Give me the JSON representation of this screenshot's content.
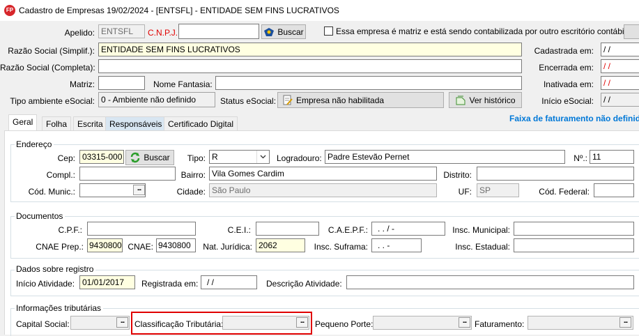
{
  "window": {
    "title": "Cadastro de Empresas  19/02/2024 - [ENTSFL] - ENTIDADE SEM FINS LUCRATIVOS",
    "icon_text": "FP"
  },
  "header": {
    "apelido_label": "Apelido:",
    "apelido_value": "ENTSFL",
    "cnpj_label": "C.N.P.J.:",
    "cnpj_value": "",
    "buscar_label": "Buscar",
    "matriz_check_label": "Essa empresa é matriz e está sendo contabilizada por outro escritório contábil",
    "razao_simpl_label": "Razão Social (Simplif.):",
    "razao_simpl_value": "ENTIDADE SEM FINS LUCRATIVOS",
    "razao_compl_label": "Razão Social (Completa):",
    "razao_compl_value": "",
    "matriz_label": "Matriz:",
    "matriz_value": "",
    "nome_fantasia_label": "Nome Fantasia:",
    "nome_fantasia_value": "",
    "tipo_amb_label": "Tipo ambiente eSocial:",
    "tipo_amb_value": "0 - Ambiente não definido",
    "status_label": "Status eSocial:",
    "status_value": "Empresa não habilitada",
    "historico_label": "Ver histórico",
    "cadastrada_label": "Cadastrada em:",
    "cadastrada_value": "/  /",
    "encerrada_label": "Encerrada em:",
    "encerrada_value": "/  /",
    "inativada_label": "Inativada em:",
    "inativada_value": "/  /",
    "inicio_esocial_label": "Início eSocial:",
    "inicio_esocial_value": "/  /"
  },
  "tabs": [
    {
      "label": "Geral"
    },
    {
      "label": "Folha"
    },
    {
      "label": "Escrita"
    },
    {
      "label": "Responsáveis"
    },
    {
      "label": "Certificado Digital"
    }
  ],
  "faixa_text": "Faixa de faturamento não definida",
  "endereco": {
    "title": "Endereço",
    "cep_label": "Cep:",
    "cep_value": "03315-000",
    "buscar_label": "Buscar",
    "tipo_label": "Tipo:",
    "tipo_value": "R",
    "logradouro_label": "Logradouro:",
    "logradouro_value": "Padre Estevão Pernet",
    "numero_label": "Nº.:",
    "numero_value": "11",
    "compl_label": "Compl.:",
    "compl_value": "",
    "bairro_label": "Bairro:",
    "bairro_value": "Vila Gomes Cardim",
    "distrito_label": "Distrito:",
    "distrito_value": "",
    "cod_munic_label": "Cód. Munic.:",
    "cod_munic_value": "",
    "cidade_label": "Cidade:",
    "cidade_value": "São Paulo",
    "uf_label": "UF:",
    "uf_value": "SP",
    "cod_federal_label": "Cód. Federal:",
    "cod_federal_value": ""
  },
  "documentos": {
    "title": "Documentos",
    "cpf_label": "C.P.F.:",
    "cpf_value": "",
    "cei_label": "C.E.I.:",
    "cei_value": "",
    "caepf_label": "C.A.E.P.F.:",
    "caepf_value": ".  .  /  -",
    "insc_municipal_label": "Insc. Municipal:",
    "insc_municipal_value": "",
    "cnae_prep_label": "CNAE Prep.:",
    "cnae_prep_value": "9430800",
    "cnae_label": "CNAE:",
    "cnae_value": "9430800",
    "nat_juridica_label": "Nat. Jurídica:",
    "nat_juridica_value": "2062",
    "insc_suframa_label": "Insc. Suframa:",
    "insc_suframa_value": ".  .  -",
    "insc_estadual_label": "Insc. Estadual:",
    "insc_estadual_value": ""
  },
  "registro": {
    "title": "Dados sobre registro",
    "inicio_label": "Início Atividade:",
    "inicio_value": "01/01/2017",
    "registrada_label": "Registrada em:",
    "registrada_value": "/  /",
    "descricao_label": "Descrição Atividade:",
    "descricao_value": ""
  },
  "tributarias": {
    "title": "Informações tributárias",
    "capital_label": "Capital Social:",
    "classificacao_label": "Classificação Tributária:",
    "pequeno_label": "Pequeno Porte:",
    "faturamento_label": "Faturamento:",
    "dots": "..."
  },
  "colors": {
    "highlight_box": "#e00000",
    "link_blue": "#0078d7",
    "required_red": "#e00000"
  }
}
